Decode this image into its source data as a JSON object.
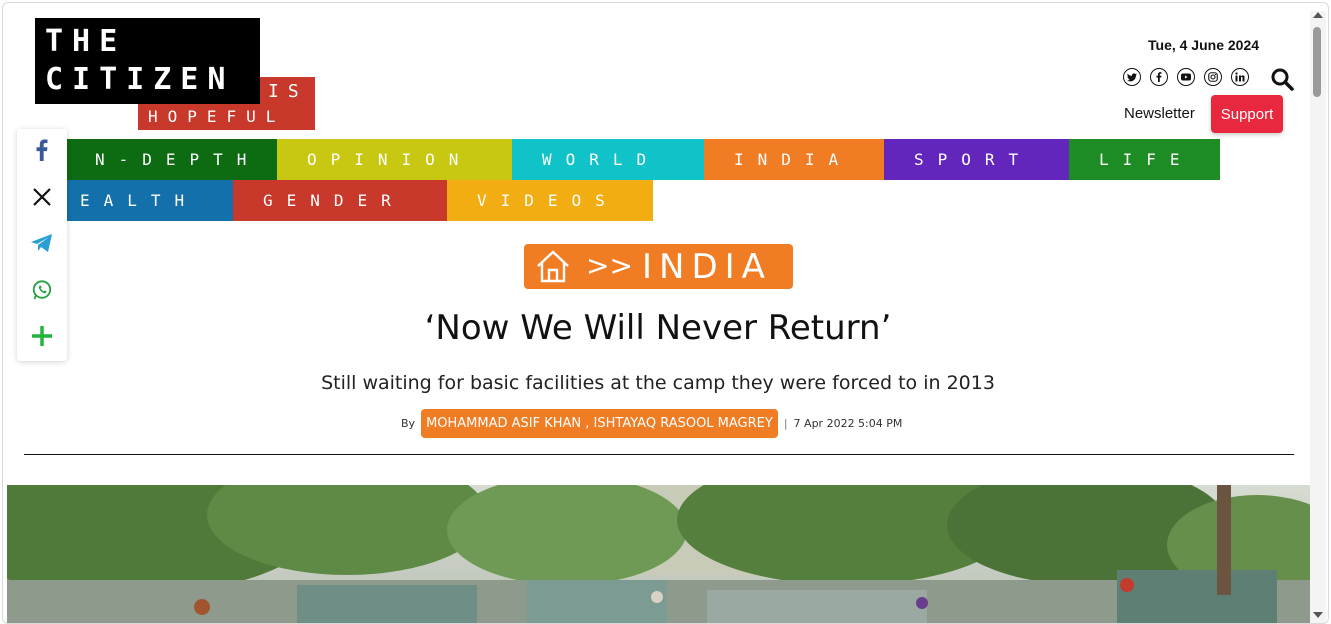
{
  "logo": {
    "line1": "THE",
    "line2": "CITIZEN",
    "tagline_is": "IS",
    "tagline_hopeful": "HOPEFUL"
  },
  "header": {
    "date": "Tue, 4 June 2024",
    "newsletter_label": "Newsletter",
    "support_label": "Support"
  },
  "social_icons": [
    "twitter-icon",
    "facebook-icon",
    "youtube-icon",
    "instagram-icon",
    "linkedin-icon"
  ],
  "nav": [
    {
      "label": "N-DEPTH",
      "color": "#0d6b12"
    },
    {
      "label": "OPINION",
      "color": "#c8c712"
    },
    {
      "label": "WORLD",
      "color": "#10c3c8"
    },
    {
      "label": "INDIA",
      "color": "#f07d24"
    },
    {
      "label": "SPORT",
      "color": "#6326bd"
    },
    {
      "label": "LIFE",
      "color": "#1d8c24"
    },
    {
      "label": "EALTH",
      "color": "#1470aa"
    },
    {
      "label": "GENDER",
      "color": "#c8392b"
    },
    {
      "label": "VIDEOS",
      "color": "#f1ad12"
    }
  ],
  "share_icons": [
    "facebook-share-icon",
    "x-share-icon",
    "telegram-share-icon",
    "whatsapp-share-icon",
    "more-share-icon"
  ],
  "article": {
    "breadcrumb_arrow": ">>",
    "breadcrumb_section": "INDIA",
    "title": "‘Now We Will Never Return’",
    "subtitle": "Still waiting for basic facilities at the camp they were forced to in 2013",
    "by_label": "By",
    "authors": "MOHAMMAD ASIF KHAN , ISHTAYAQ RASOOL MAGREY",
    "separator": "|",
    "timestamp": "7 Apr 2022 5:04 PM"
  },
  "colors": {
    "accent_orange": "#f07d24",
    "support_red": "#e8283f",
    "logo_red": "#c8392b"
  }
}
